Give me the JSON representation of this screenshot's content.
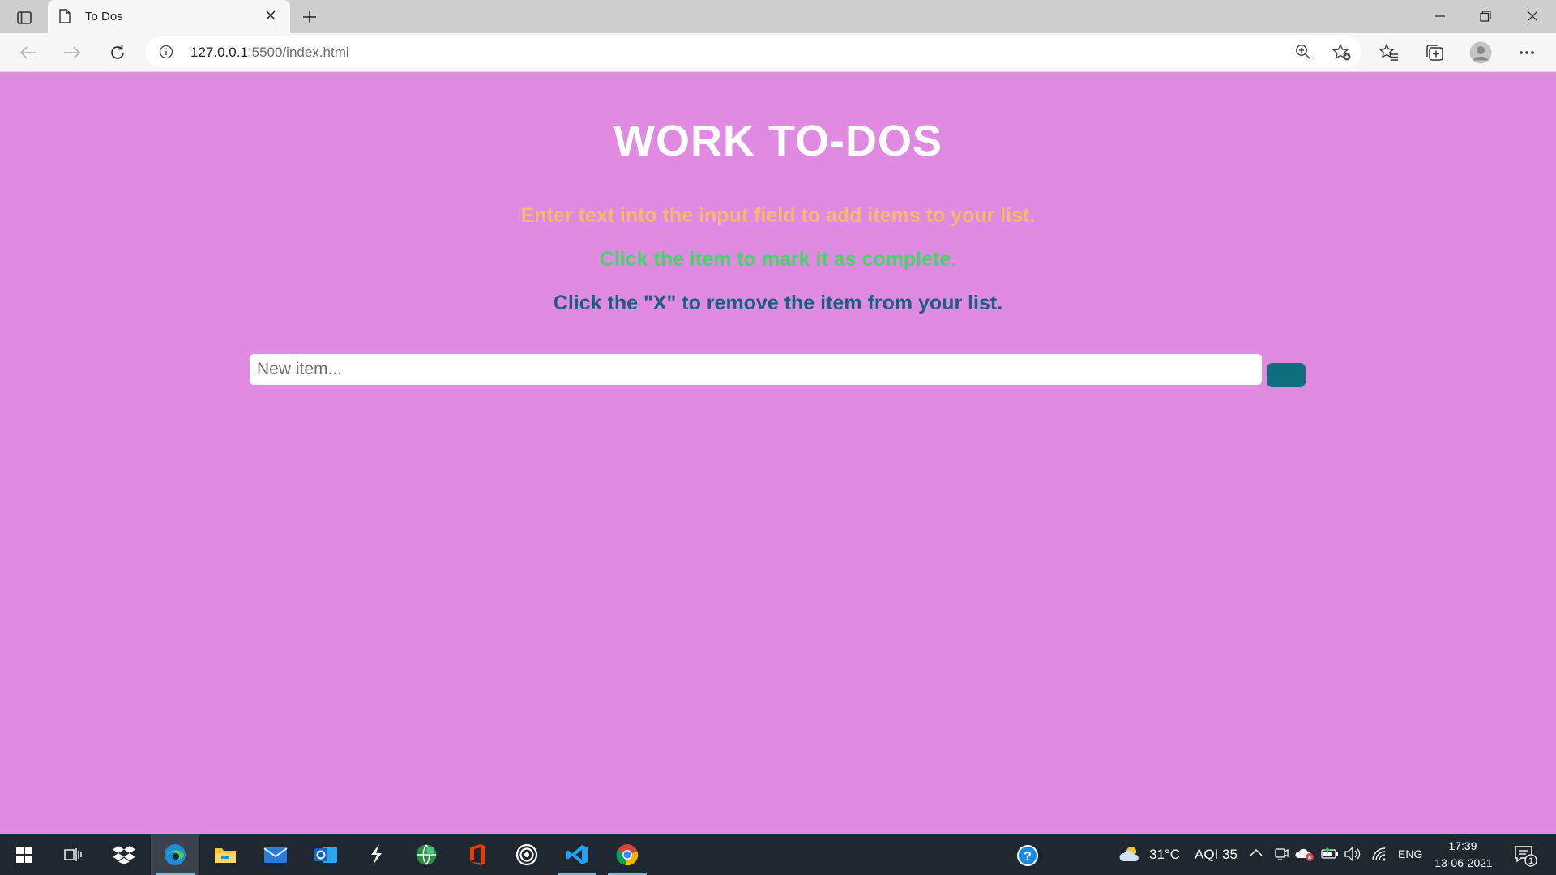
{
  "browser": {
    "tab_title": "To Dos",
    "url_host": "127.0.0.1",
    "url_rest": ":5500/index.html"
  },
  "page": {
    "heading": "WORK TO-DOS",
    "instructions": [
      "Enter text into the input field to add items to your list.",
      "Click the item to mark it as complete.",
      "Click the \"X\" to remove the item from your list."
    ],
    "new_item_placeholder": "New item...",
    "new_item_value": "",
    "colors": {
      "background": "#e08ae2",
      "heading": "#ffffff",
      "instruction_1": "#f6b86d",
      "instruction_2": "#47d36a",
      "instruction_3": "#1d5e7c",
      "add_button": "#0f6e7d"
    }
  },
  "taskbar": {
    "apps": [
      "windows-start-icon",
      "task-view-icon",
      "dropbox-icon",
      "edge-icon",
      "file-explorer-icon",
      "mail-icon",
      "outlook-icon",
      "app-s-icon",
      "globe-app-icon",
      "office-icon",
      "record-app-icon",
      "vscode-icon",
      "chrome-icon"
    ],
    "weather_temp": "31°C",
    "weather_aqi": "AQI 35",
    "language": "ENG",
    "time": "17:39",
    "date": "13-06-2021",
    "notification_count": "1"
  }
}
